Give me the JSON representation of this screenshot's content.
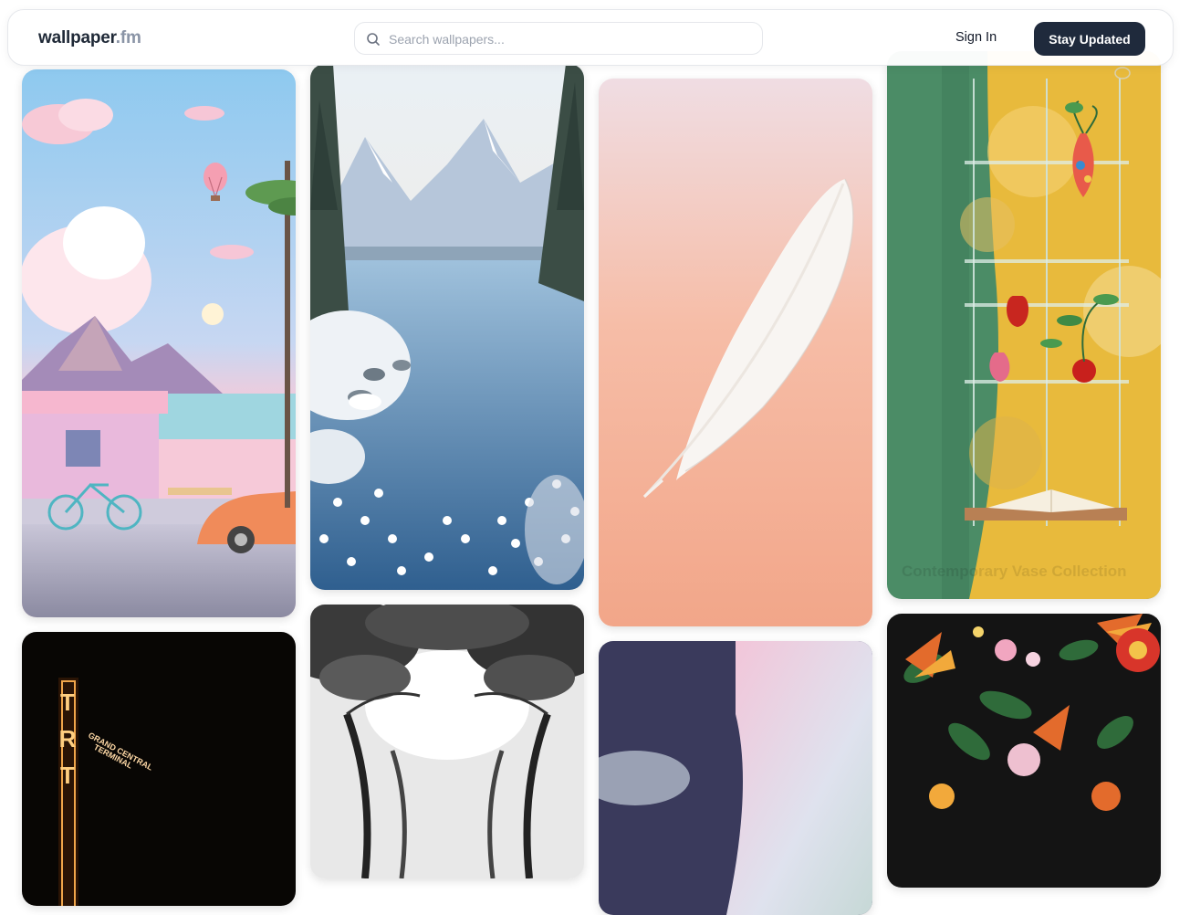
{
  "header": {
    "logo_main": "wallpaper",
    "logo_ext": ".fm",
    "search_placeholder": "Search wallpapers...",
    "signin_label": "Sign In",
    "cta_label": "Stay Updated"
  },
  "tiles": {
    "vase_caption": "Contemporary Vase Collection",
    "neon_sign_letters": "T R T",
    "neon_sign_text": "GRAND CENTRAL TERMINAL"
  },
  "colors": {
    "cta_bg": "#1f2a3c",
    "logo_main": "#1f2937",
    "logo_ext": "#8a94a6"
  }
}
